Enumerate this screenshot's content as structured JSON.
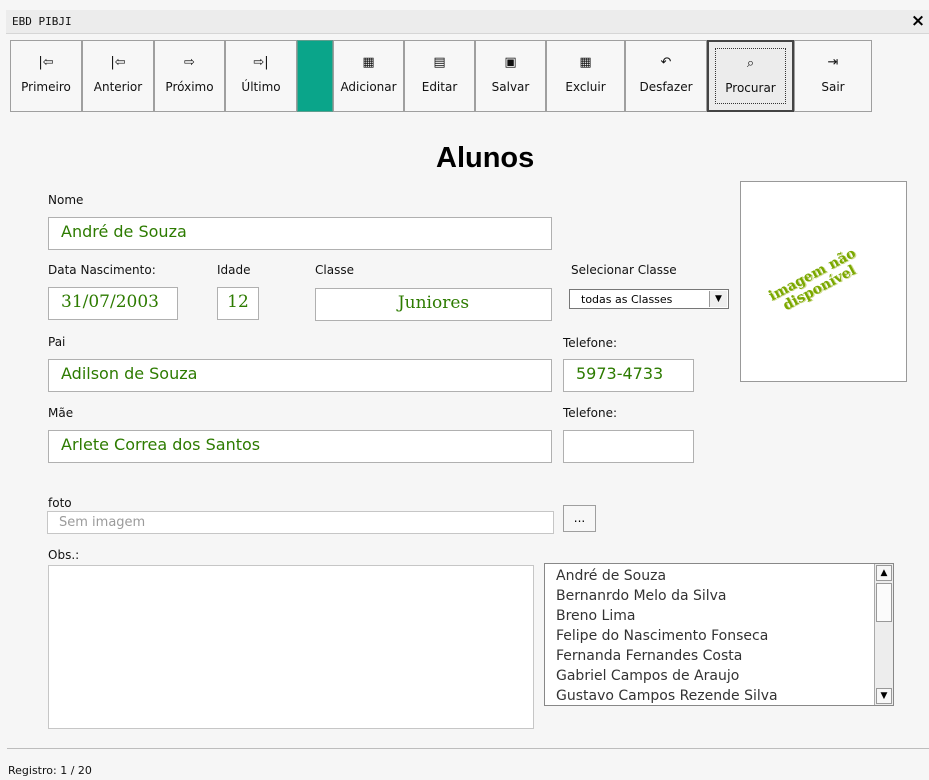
{
  "window": {
    "title": "EBD PIBJI",
    "close_label": "×"
  },
  "toolbar": {
    "buttons": [
      {
        "label": "Primeiro",
        "icon": "first-record-icon",
        "glyph": "|⇦"
      },
      {
        "label": "Anterior",
        "icon": "previous-record-icon",
        "glyph": "|⇦"
      },
      {
        "label": "Próximo",
        "icon": "next-record-icon",
        "glyph": "⇨"
      },
      {
        "label": "Último",
        "icon": "last-record-icon",
        "glyph": "⇨|"
      },
      {
        "label": "Adicionar",
        "icon": "add-icon",
        "glyph": "▦"
      },
      {
        "label": "Editar",
        "icon": "edit-icon",
        "glyph": "▤"
      },
      {
        "label": "Salvar",
        "icon": "save-icon",
        "glyph": "▣"
      },
      {
        "label": "Excluir",
        "icon": "delete-icon",
        "glyph": "▦"
      },
      {
        "label": "Desfazer",
        "icon": "undo-icon",
        "glyph": "↶"
      },
      {
        "label": "Procurar",
        "icon": "search-icon",
        "glyph": "⌕"
      },
      {
        "label": "Sair",
        "icon": "exit-icon",
        "glyph": "⇥"
      }
    ],
    "accent_color": "#0aa58a"
  },
  "form": {
    "title": "Alunos",
    "nome_label": "Nome",
    "nome": "André de Souza",
    "nascimento_label": "Data Nascimento:",
    "nascimento": "31/07/2003",
    "idade_label": "Idade",
    "idade": "12",
    "classe_label": "Classe",
    "classe": "Juniores",
    "selecionar_classe_label": "Selecionar Classe",
    "selecionar_classe_value": "todas as Classes",
    "pai_label": "Pai",
    "pai": "Adilson de Souza",
    "telefone_pai_label": "Telefone:",
    "telefone_pai": "5973-4733",
    "mae_label": "Mãe",
    "mae": "Arlete Correa dos Santos",
    "telefone_mae_label": "Telefone:",
    "telefone_mae": "",
    "photo_placeholder_line1": "imagem não",
    "photo_placeholder_line2": "disponível",
    "foto_label": "foto",
    "foto_path_placeholder": "Sem imagem",
    "browse_label": "...",
    "obs_label": "Obs.:",
    "obs": ""
  },
  "students": [
    "André de Souza",
    "Bernanrdo Melo da Silva",
    "Breno Lima",
    "Felipe do Nascimento Fonseca",
    "Fernanda Fernandes Costa",
    "Gabriel Campos de Araujo",
    "Gustavo Campos Rezende Silva"
  ],
  "status": {
    "record": "Registro: 1 / 20"
  }
}
